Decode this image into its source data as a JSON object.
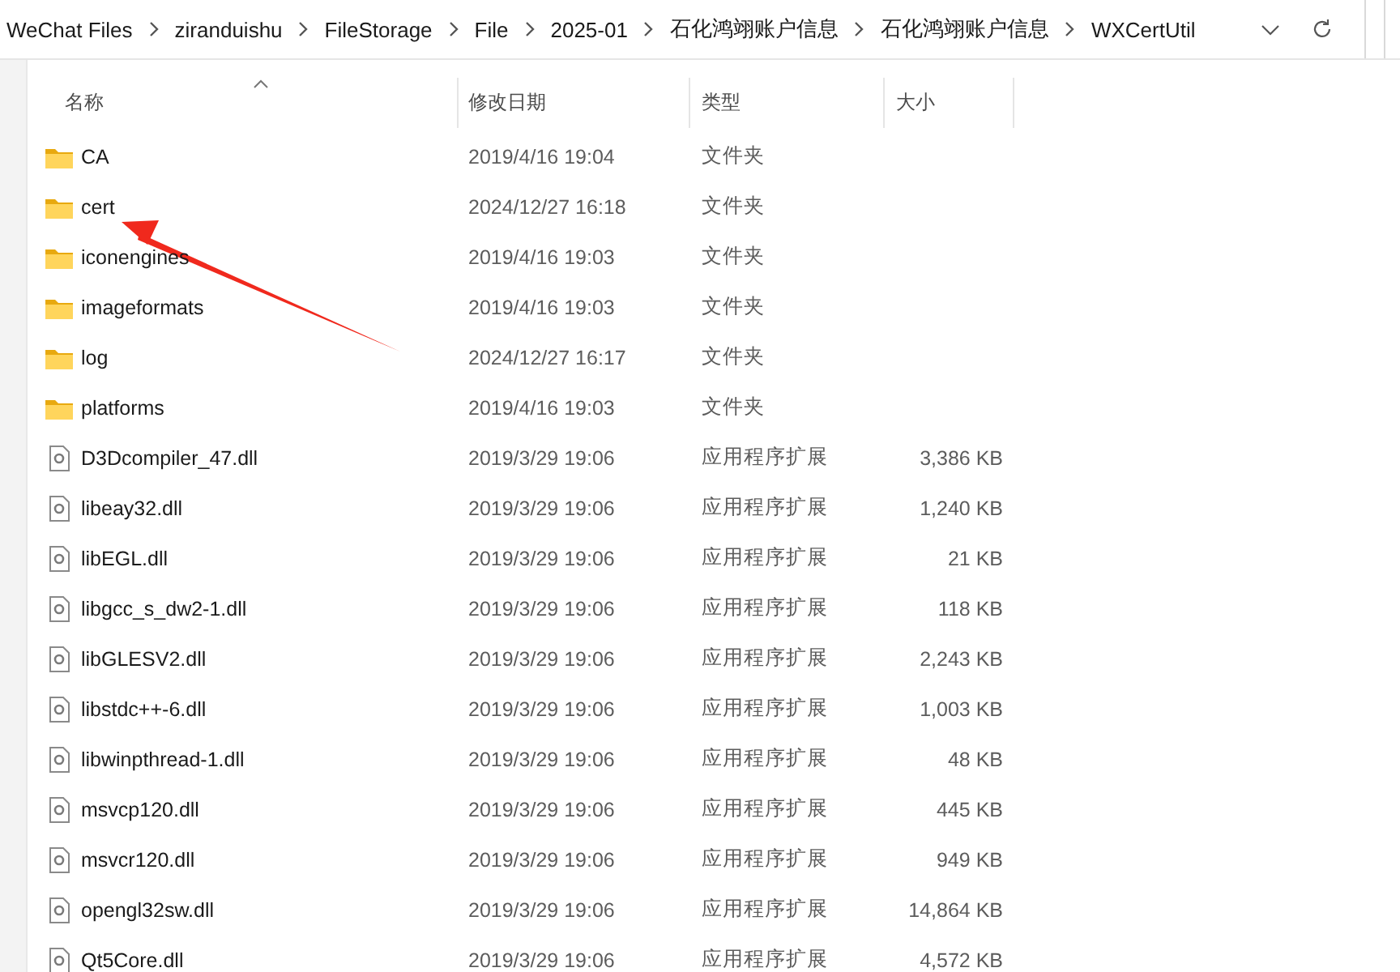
{
  "address_bar": {
    "breadcrumbs": [
      "WeChat Files",
      "ziranduishu",
      "FileStorage",
      "File",
      "2025-01",
      "石化鸿翊账户信息",
      "石化鸿翊账户信息",
      "WXCertUtil"
    ]
  },
  "columns": [
    {
      "label": "名称",
      "sorted": true
    },
    {
      "label": "修改日期",
      "sorted": false
    },
    {
      "label": "类型",
      "sorted": false
    },
    {
      "label": "大小",
      "sorted": false
    }
  ],
  "files": [
    {
      "kind": "folder",
      "name": "CA",
      "modified": "2019/4/16 19:04",
      "type": "文件夹"
    },
    {
      "kind": "folder",
      "name": "cert",
      "modified": "2024/12/27 16:18",
      "type": "文件夹"
    },
    {
      "kind": "folder",
      "name": "iconengines",
      "modified": "2019/4/16 19:03",
      "type": "文件夹"
    },
    {
      "kind": "folder",
      "name": "imageformats",
      "modified": "2019/4/16 19:03",
      "type": "文件夹"
    },
    {
      "kind": "folder",
      "name": "log",
      "modified": "2024/12/27 16:17",
      "type": "文件夹"
    },
    {
      "kind": "folder",
      "name": "platforms",
      "modified": "2019/4/16 19:03",
      "type": "文件夹"
    },
    {
      "kind": "dll",
      "name": "D3Dcompiler_47.dll",
      "modified": "2019/3/29 19:06",
      "type": "应用程序扩展",
      "size": "3,386 KB"
    },
    {
      "kind": "dll",
      "name": "libeay32.dll",
      "modified": "2019/3/29 19:06",
      "type": "应用程序扩展",
      "size": "1,240 KB"
    },
    {
      "kind": "dll",
      "name": "libEGL.dll",
      "modified": "2019/3/29 19:06",
      "type": "应用程序扩展",
      "size": "21 KB"
    },
    {
      "kind": "dll",
      "name": "libgcc_s_dw2-1.dll",
      "modified": "2019/3/29 19:06",
      "type": "应用程序扩展",
      "size": "118 KB"
    },
    {
      "kind": "dll",
      "name": "libGLESV2.dll",
      "modified": "2019/3/29 19:06",
      "type": "应用程序扩展",
      "size": "2,243 KB"
    },
    {
      "kind": "dll",
      "name": "libstdc++-6.dll",
      "modified": "2019/3/29 19:06",
      "type": "应用程序扩展",
      "size": "1,003 KB"
    },
    {
      "kind": "dll",
      "name": "libwinpthread-1.dll",
      "modified": "2019/3/29 19:06",
      "type": "应用程序扩展",
      "size": "48 KB"
    },
    {
      "kind": "dll",
      "name": "msvcp120.dll",
      "modified": "2019/3/29 19:06",
      "type": "应用程序扩展",
      "size": "445 KB"
    },
    {
      "kind": "dll",
      "name": "msvcr120.dll",
      "modified": "2019/3/29 19:06",
      "type": "应用程序扩展",
      "size": "949 KB"
    },
    {
      "kind": "dll",
      "name": "opengl32sw.dll",
      "modified": "2019/3/29 19:06",
      "type": "应用程序扩展",
      "size": "14,864 KB"
    },
    {
      "kind": "dll",
      "name": "Qt5Core.dll",
      "modified": "2019/3/29 19:06",
      "type": "应用程序扩展",
      "size": "4,572 KB"
    }
  ]
}
